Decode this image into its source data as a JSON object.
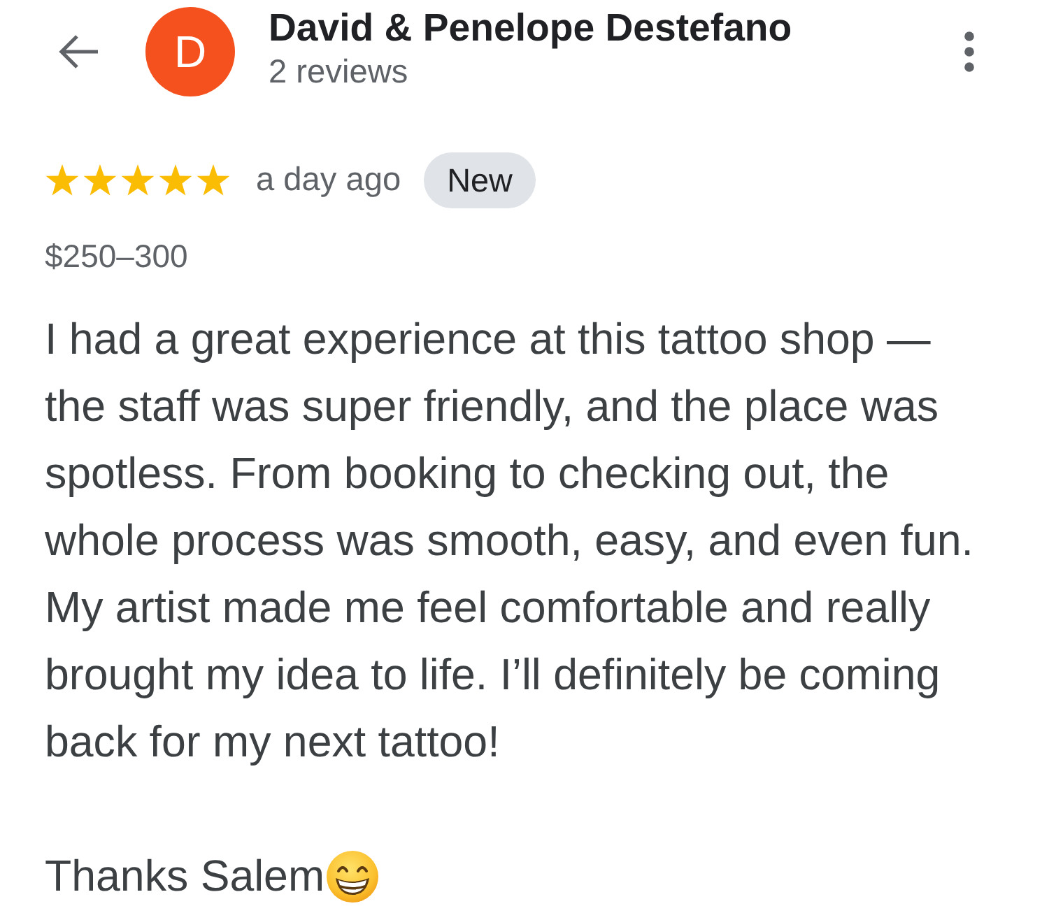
{
  "reviewer": {
    "avatar_letter": "D",
    "name": "David & Penelope Destefano",
    "review_count": "2 reviews"
  },
  "review": {
    "stars": 5,
    "time": "a day ago",
    "badge": "New",
    "price": "$250–300",
    "body": "I had a great experience at this tattoo shop — the staff was super friendly, and the place was spotless. From booking to checking out, the whole process was smooth, easy, and even fun. My artist made me feel comfortable and really brought my idea to life. I’ll definitely be coming back for my next tattoo!",
    "closing": "Thanks Salem"
  }
}
